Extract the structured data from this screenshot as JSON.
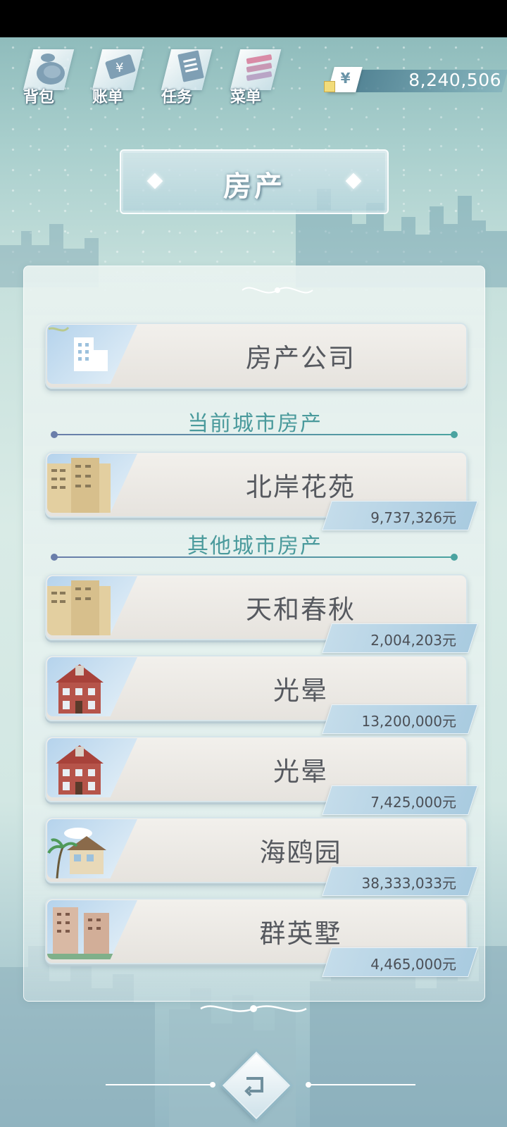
{
  "toolbar": {
    "bag": {
      "label": "背包",
      "icon": "bag-icon"
    },
    "bill": {
      "label": "账单",
      "icon": "yen-bill-icon"
    },
    "tasks": {
      "label": "任务",
      "icon": "task-list-icon"
    },
    "menu": {
      "label": "菜单",
      "icon": "menu-icon"
    }
  },
  "money": {
    "currency_symbol": "¥",
    "amount": "8,240,506"
  },
  "page": {
    "title": "房产"
  },
  "company": {
    "label": "房产公司"
  },
  "sections": {
    "current_city": "当前城市房产",
    "other_city": "其他城市房产"
  },
  "current_properties": [
    {
      "name": "北岸花苑",
      "price": "9,737,326元",
      "thumb": "apartment-block"
    }
  ],
  "other_properties": [
    {
      "name": "天和春秋",
      "price": "2,004,203元",
      "thumb": "apartment-block"
    },
    {
      "name": "光晕",
      "price": "13,200,000元",
      "thumb": "red-house"
    },
    {
      "name": "光晕",
      "price": "7,425,000元",
      "thumb": "red-house"
    },
    {
      "name": "海鸥园",
      "price": "38,333,033元",
      "thumb": "beach-villa"
    },
    {
      "name": "群英墅",
      "price": "4,465,000元",
      "thumb": "residential-tower"
    }
  ],
  "colors": {
    "accent_teal": "#4a9a9c",
    "card_bg": "#f2f0ec",
    "price_tag": "#a9cbe0"
  }
}
